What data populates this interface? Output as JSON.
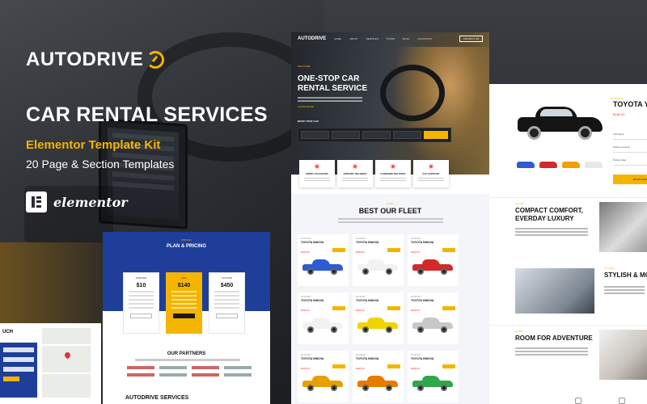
{
  "brand": {
    "name": "AUTODRIVE"
  },
  "hero": {
    "title": "CAR RENTAL SERVICES",
    "subtitle": "Elementor Template Kit",
    "templates": "20 Page & Section Templates"
  },
  "elementor": {
    "label": "elementor"
  },
  "colors": {
    "accent": "#f5b400",
    "navy": "#1e3e9a",
    "dark": "#2a2d33",
    "price": "#e33333"
  },
  "pricing": {
    "eyebrow": "PRICING",
    "heading": "PLAN & PRICING",
    "plans": [
      {
        "name": "STARTER",
        "price": "$10"
      },
      {
        "name": "PRO",
        "price": "$140"
      },
      {
        "name": "CUSTOM",
        "price": "$450"
      }
    ],
    "partners_eyebrow": "PARTNERS",
    "partners_heading": "OUR PARTNERS",
    "footer_heading": "AUTODRIVE SERVICES"
  },
  "contact": {
    "heading": "UCH"
  },
  "site": {
    "logo": "AUTODRIVE",
    "nav": [
      "HOME",
      "ABOUT",
      "SERVICES",
      "TOURS",
      "BLOG",
      "LOCATIONS"
    ],
    "nav_cta": "CONTACT US",
    "eyebrow": "WELCOME",
    "hero_title": "ONE-STOP CAR RENTAL SERVICE",
    "learn_more": "LEARN MORE",
    "book_label": "BOOK YOUR CAR",
    "book_button": "BOOK NOW",
    "features": [
      {
        "label": "MORE LOCATIONS"
      },
      {
        "label": "AIRPORT DELIVERY"
      },
      {
        "label": "CURBSIDE DELIVERY"
      },
      {
        "label": "24/7 SUPPORT"
      }
    ],
    "fleet_eyebrow": "FLEET",
    "fleet_title": "BEST OUR FLEET",
    "cars": [
      {
        "label": "ECONOMY",
        "name": "TOYOTA INNOVA",
        "price": "$180.00",
        "color": "#2f5bd3"
      },
      {
        "label": "ECONOMY",
        "name": "TOYOTA INNOVA",
        "price": "$180.00",
        "color": "#f2f2f2"
      },
      {
        "label": "ECONOMY",
        "name": "TOYOTA INNOVA",
        "price": "$180.00",
        "color": "#d22a2a"
      },
      {
        "label": "ECONOMY",
        "name": "TOYOTA INNOVA",
        "price": "$180.00",
        "color": "#f2f2f2"
      },
      {
        "label": "ECONOMY",
        "name": "TOYOTA INNOVA",
        "price": "$180.00",
        "color": "#f0d400"
      },
      {
        "label": "ECONOMY",
        "name": "TOYOTA INNOVA",
        "price": "$180.00",
        "color": "#c8c8c8"
      },
      {
        "label": "ECONOMY",
        "name": "TOYOTA INNOVA",
        "price": "$180.00",
        "color": "#e8a000"
      },
      {
        "label": "ECONOMY",
        "name": "TOYOTA INNOVA",
        "price": "$180.00",
        "color": "#e87a00"
      },
      {
        "label": "ECONOMY",
        "name": "TOYOTA INNOVA",
        "price": "$180.00",
        "color": "#2ea84a"
      }
    ]
  },
  "detail": {
    "eyebrow": "ECONOMY",
    "title": "TOYOTA YA",
    "price": "$180.00",
    "fields": [
      "Full Name",
      "Pickup Location",
      "Pickup Date"
    ],
    "button": "BOOK NOW",
    "thumb_colors": [
      "#2f5bd3",
      "#d22a2a",
      "#f0a000",
      "#e8e8e8"
    ],
    "sections": [
      {
        "eyebrow": "LUXURY",
        "title": "COMPACT COMFORT, EVERDAY LUXURY"
      },
      {
        "eyebrow": "STYLISH",
        "title": "STYLISH & MO"
      },
      {
        "eyebrow": "ROOM",
        "title": "ROOM FOR ADVENTURE"
      }
    ]
  }
}
